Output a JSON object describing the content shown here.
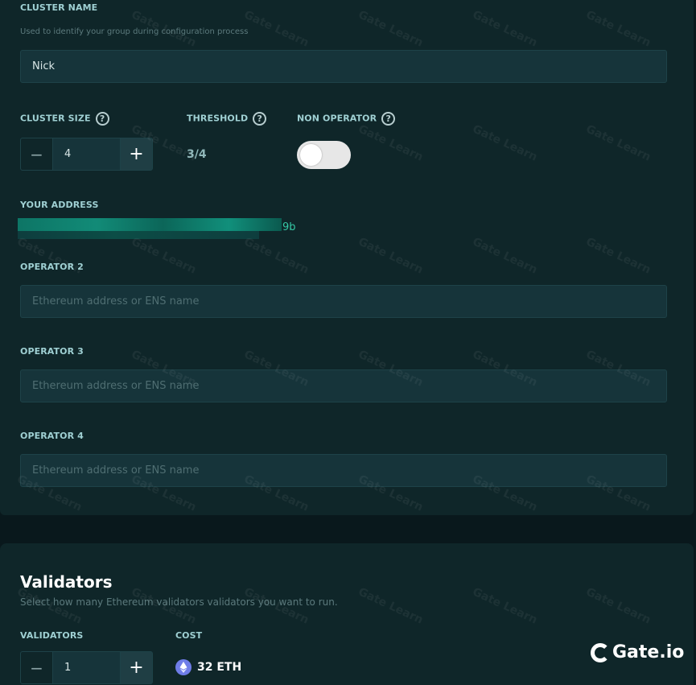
{
  "cluster": {
    "name_label": "CLUSTER NAME",
    "name_hint": "Used to identify your group during configuration process",
    "name_value": "Nick",
    "size_label": "CLUSTER SIZE",
    "size_value": "4",
    "threshold_label": "THRESHOLD",
    "threshold_value": "3/4",
    "non_operator_label": "NON OPERATOR",
    "non_operator_enabled": false,
    "help_glyph": "?",
    "minus_glyph": "−",
    "plus_glyph": "+"
  },
  "address": {
    "label": "YOUR ADDRESS",
    "visible_suffix": "9b"
  },
  "operators": [
    {
      "label": "OPERATOR 2",
      "placeholder": "Ethereum address or ENS name"
    },
    {
      "label": "OPERATOR 3",
      "placeholder": "Ethereum address or ENS name"
    },
    {
      "label": "OPERATOR 4",
      "placeholder": "Ethereum address or ENS name"
    }
  ],
  "validators": {
    "title": "Validators",
    "subtitle": "Select how many Ethereum validators validators you want to run.",
    "count_label": "VALIDATORS",
    "count_value": "1",
    "cost_label": "COST",
    "cost_value": "32 ETH"
  },
  "watermark": {
    "text": "Gate Learn",
    "brand": "Gate.io"
  },
  "colors": {
    "background": "#09181c",
    "panel": "#0f2629",
    "input": "#16343a",
    "label": "#9fd0d3",
    "accent_green": "#35c9a6",
    "eth": "#6f7de8"
  }
}
